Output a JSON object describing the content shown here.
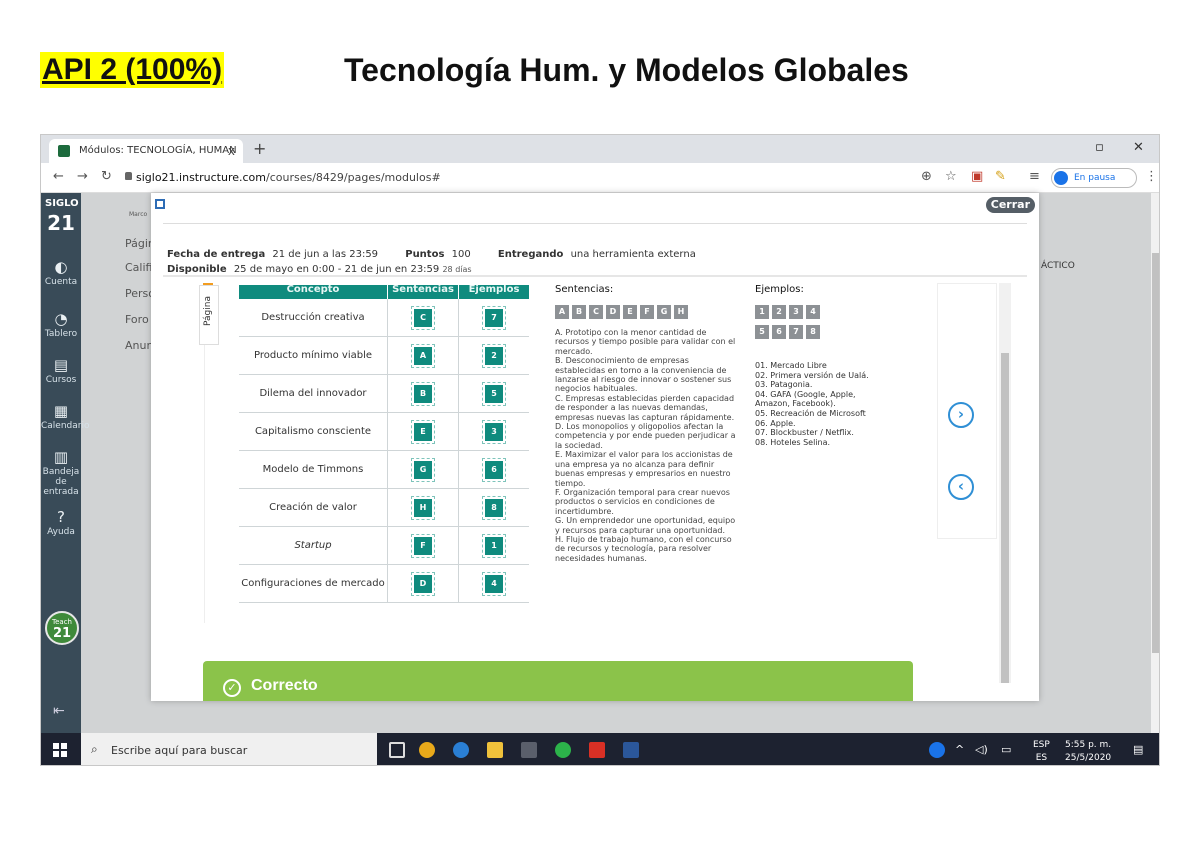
{
  "doc": {
    "badge": "API 2 (100%)",
    "title": "Tecnología Hum. y Modelos Globales"
  },
  "browser": {
    "tab_title": "Módulos: TECNOLOGÍA, HUMAN",
    "tab_close": "x",
    "new_tab": "+",
    "url_host": "siglo21.instructure.com",
    "url_path": "/courses/8429/pages/modulos#",
    "pause_label": "En pausa"
  },
  "sidebar": {
    "logo_top": "SIGLO",
    "logo_bottom": "21",
    "items": [
      {
        "label": "Cuenta",
        "icon": "account-icon",
        "glyph": "◐"
      },
      {
        "label": "Tablero",
        "icon": "dashboard-icon",
        "glyph": "◔"
      },
      {
        "label": "Cursos",
        "icon": "courses-icon",
        "glyph": "▤"
      },
      {
        "label": "Calendario",
        "icon": "calendar-icon",
        "glyph": "▦"
      },
      {
        "label": "Bandeja de entrada",
        "icon": "inbox-icon",
        "glyph": "▥"
      },
      {
        "label": "Ayuda",
        "icon": "help-icon",
        "glyph": "?"
      }
    ],
    "teach_top": "Teach",
    "teach_bottom": "21"
  },
  "background": {
    "nav_fragments": [
      "Págin",
      "Califi",
      "Perso",
      "Foro",
      "Anun"
    ],
    "mini_label": "Marco",
    "right_fragment": "ÁCTICO"
  },
  "modal": {
    "close_label": "Cerrar",
    "fecha_label": "Fecha de entrega",
    "fecha_value": "21 de jun a las 23:59",
    "puntos_label": "Puntos",
    "puntos_value": "100",
    "entregando_label": "Entregando",
    "entregando_value": "una herramienta externa",
    "disponible_label": "Disponible",
    "disponible_value": "25 de mayo en 0:00 - 21 de jun en 23:59",
    "disponible_days": "28 días",
    "pagina_label": "Página",
    "correct_label": "Correcto"
  },
  "table": {
    "headers": [
      "Concepto",
      "Sentencias",
      "Ejemplos"
    ],
    "rows": [
      {
        "concept": "Destrucción creativa",
        "sentence": "C",
        "example": "7",
        "italic": false
      },
      {
        "concept": "Producto mínimo viable",
        "sentence": "A",
        "example": "2",
        "italic": false
      },
      {
        "concept": "Dilema del innovador",
        "sentence": "B",
        "example": "5",
        "italic": false
      },
      {
        "concept": "Capitalismo consciente",
        "sentence": "E",
        "example": "3",
        "italic": false
      },
      {
        "concept": "Modelo de Timmons",
        "sentence": "G",
        "example": "6",
        "italic": false
      },
      {
        "concept": "Creación de valor",
        "sentence": "H",
        "example": "8",
        "italic": false
      },
      {
        "concept": "Startup",
        "sentence": "F",
        "example": "1",
        "italic": true
      },
      {
        "concept": "Configuraciones de mercado",
        "sentence": "D",
        "example": "4",
        "italic": false
      }
    ]
  },
  "sentences": {
    "title": "Sentencias:",
    "letters": [
      "A",
      "B",
      "C",
      "D",
      "E",
      "F",
      "G",
      "H"
    ],
    "items": [
      "A. Prototipo con la menor cantidad de recursos y tiempo posible para validar con el mercado.",
      "B. Desconocimiento de empresas establecidas en torno a la conveniencia de lanzarse al riesgo de innovar o sostener sus negocios habituales.",
      "C. Empresas establecidas pierden capacidad de responder a las nuevas demandas, empresas nuevas las capturan rápidamente.",
      "D. Los monopolios y oligopolios afectan la competencia y por ende pueden perjudicar a la sociedad.",
      "E. Maximizar el valor para los accionistas de una empresa ya no alcanza para definir buenas empresas y empresarios en nuestro tiempo.",
      "F. Organización temporal para crear nuevos productos o servicios en condiciones de incertidumbre.",
      "G. Un emprendedor une oportunidad, equipo y recursos para capturar una oportunidad.",
      "H. Flujo de trabajo humano, con el concurso de recursos y tecnología, para resolver necesidades humanas."
    ]
  },
  "examples": {
    "title": "Ejemplos:",
    "numbers_row1": [
      "1",
      "2",
      "3",
      "4"
    ],
    "numbers_row2": [
      "5",
      "6",
      "7",
      "8"
    ],
    "items": [
      "01. Mercado Libre",
      "02. Primera versión de Ualá.",
      "03. Patagonia.",
      "04. GAFA (Google, Apple, Amazon, Facebook).",
      "05. Recreación de Microsoft",
      "06. Apple.",
      "07. Blockbuster / Netflix.",
      "08. Hoteles Selina."
    ]
  },
  "taskbar": {
    "search_placeholder": "Escribe aquí para buscar",
    "lang_top": "ESP",
    "lang_bottom": "ES",
    "time": "5:55 p. m.",
    "date": "25/5/2020"
  },
  "colors": {
    "teal": "#0f8b7e",
    "canvas_nav": "#394b58",
    "correct_green": "#8bc34a",
    "highlight": "#ffff00",
    "link_blue": "#2f8fd5"
  }
}
